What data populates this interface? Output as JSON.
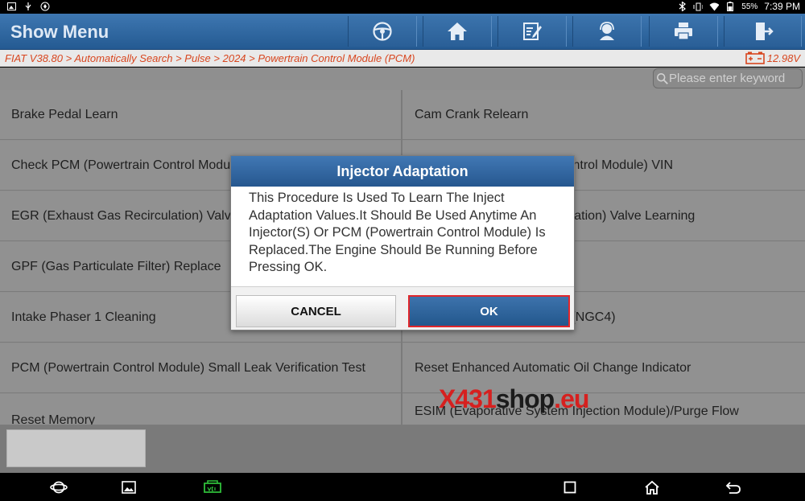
{
  "status_bar": {
    "battery": "55%",
    "time": "7:39 PM"
  },
  "header": {
    "title": "Show Menu",
    "tools": [
      "steering-wheel-icon",
      "home-icon",
      "edit-icon",
      "user-support-icon",
      "print-icon",
      "exit-icon"
    ]
  },
  "breadcrumb": {
    "path": "FIAT V38.80 > Automatically Search > Pulse > 2024 > Powertrain Control Module (PCM)",
    "voltage": "12.98V"
  },
  "search": {
    "placeholder": "Please enter keyword"
  },
  "functions": {
    "rows": [
      [
        "Brake Pedal Learn",
        "Cam Crank Relearn"
      ],
      [
        "Check PCM (Powertrain Control Module) VIN",
        "Check PCM (Powertrain Control Module) VIN"
      ],
      [
        "EGR (Exhaust Gas Recirculation) Valve Learning",
        "EGR (Exhaust Gas Recirculation) Valve Learning"
      ],
      [
        "GPF (Gas Particulate Filter) Replace",
        ""
      ],
      [
        "Intake Phaser 1 Cleaning",
        "Electronic Throttle Control) (NGC4)"
      ],
      [
        "PCM (Powertrain Control Module) Small Leak Verification Test",
        "Reset Enhanced Automatic Oil Change Indicator"
      ],
      [
        "Reset Memory",
        "ESIM (Evaporative System Injection Module)/Purge Flow"
      ]
    ]
  },
  "watermark": {
    "x": "X431",
    "shop": "shop",
    "eu": ".eu"
  },
  "dialog": {
    "title": "Injector Adaptation",
    "message": "This Procedure Is Used To Learn The Inject Adaptation Values.It Should Be Used Anytime An Injector(S) Or PCM (Powertrain Control Module) Is Replaced.The Engine Should Be Running Before Pressing OK.",
    "cancel_label": "CANCEL",
    "ok_label": "OK"
  },
  "colors": {
    "header_blue": "#2f66a0",
    "accent_red": "#d8461f",
    "ok_border": "#e0262b"
  }
}
